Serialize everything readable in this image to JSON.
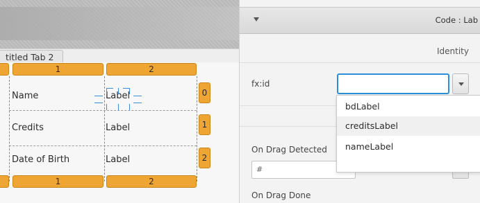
{
  "editor": {
    "tab_label": "titled Tab 2",
    "grid": {
      "column_markers": [
        "1",
        "2"
      ],
      "row_markers": [
        "0",
        "1",
        "2"
      ],
      "rows": [
        {
          "name": "Name",
          "value": "Label"
        },
        {
          "name": "Credits",
          "value": "Label"
        },
        {
          "name": "Date of Birth",
          "value": "Label"
        }
      ]
    }
  },
  "inspector": {
    "section_title": "Code : Lab",
    "group_label": "Identity",
    "fxid_label": "fx:id",
    "fxid_value": "",
    "fxid_options": [
      "bdLabel",
      "creditsLabel",
      "nameLabel"
    ],
    "fxid_highlighted_index": 1,
    "on_drag_detected_label": "On Drag Detected",
    "handler_prefix": "#",
    "on_drag_done_label": "On Drag Done"
  },
  "colors": {
    "grid_marker": "#eea534",
    "focus_ring": "#2a8ed8",
    "selection_handle": "#3a8bd8"
  }
}
